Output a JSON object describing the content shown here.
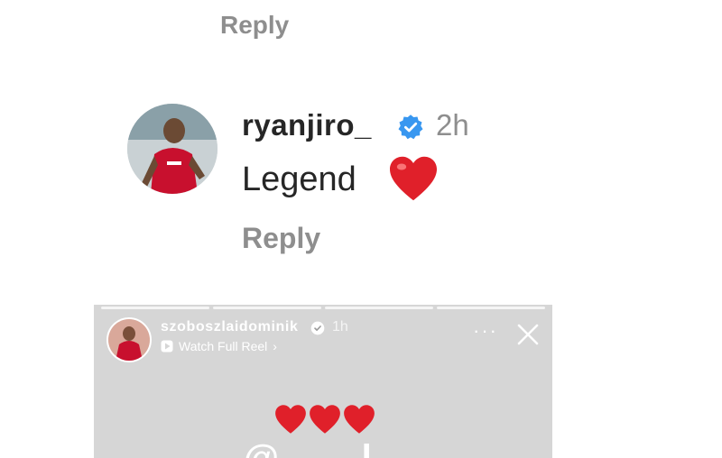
{
  "top_comment": {
    "reply_label": "Reply"
  },
  "comment": {
    "username": "ryanjiro_",
    "time": "2h",
    "text": "Legend",
    "reply_label": "Reply"
  },
  "story": {
    "username": "szoboszlaidominik",
    "time": "1h",
    "watch_label": "Watch Full Reel",
    "watch_chevron": "›",
    "more_label": "···",
    "bottom_text": "@ ... l"
  },
  "colors": {
    "verified": "#3897f0",
    "heart": "#e0202a",
    "muted_text": "#8e8e8e"
  },
  "icons": {
    "verified": "verified-badge-icon",
    "heart": "heart-icon",
    "play": "play-icon",
    "more": "more-options-icon",
    "close": "close-icon"
  }
}
